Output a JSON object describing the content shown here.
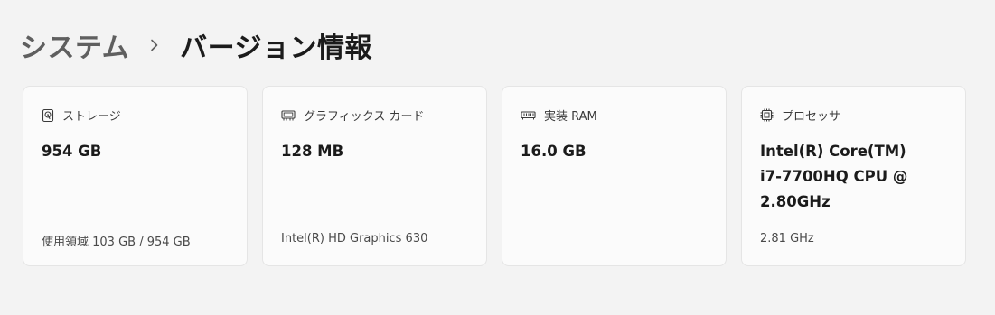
{
  "breadcrumb": {
    "parent": "システム",
    "separator_icon": "chevron-right-icon",
    "current": "バージョン情報"
  },
  "cards": [
    {
      "icon": "storage-drive-icon",
      "title": "ストレージ",
      "value": "954 GB",
      "sub": "使用領域 103 GB / 954 GB"
    },
    {
      "icon": "graphics-card-icon",
      "title": "グラフィックス カード",
      "value": "128 MB",
      "sub": "Intel(R) HD Graphics 630"
    },
    {
      "icon": "memory-ram-icon",
      "title": "実装 RAM",
      "value": "16.0 GB",
      "sub": ""
    },
    {
      "icon": "processor-chip-icon",
      "title": "プロセッサ",
      "value_lines": [
        "Intel(R) Core(TM)",
        "i7-7700HQ CPU @",
        "2.80GHz"
      ],
      "sub": "2.81 GHz"
    }
  ]
}
